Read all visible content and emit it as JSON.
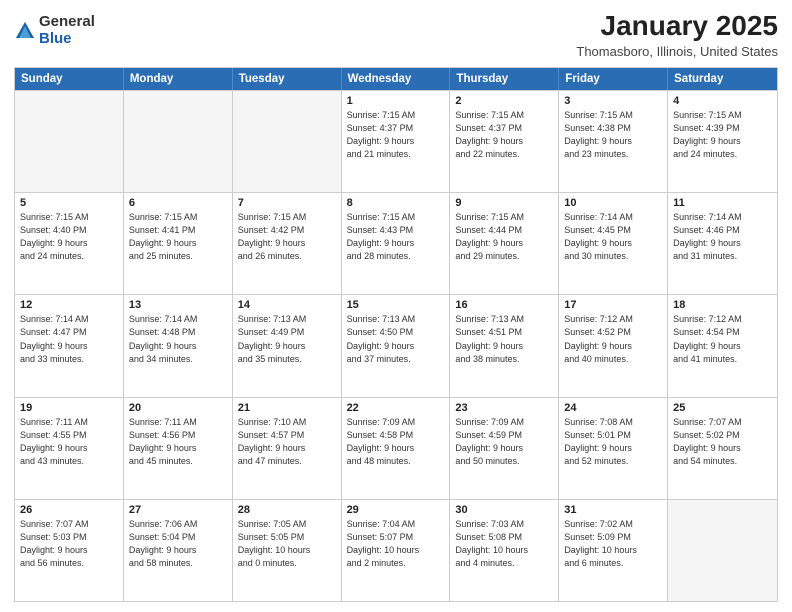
{
  "header": {
    "logo_general": "General",
    "logo_blue": "Blue",
    "title": "January 2025",
    "subtitle": "Thomasboro, Illinois, United States"
  },
  "calendar": {
    "days_of_week": [
      "Sunday",
      "Monday",
      "Tuesday",
      "Wednesday",
      "Thursday",
      "Friday",
      "Saturday"
    ],
    "rows": [
      [
        {
          "day": "",
          "lines": []
        },
        {
          "day": "",
          "lines": []
        },
        {
          "day": "",
          "lines": []
        },
        {
          "day": "1",
          "lines": [
            "Sunrise: 7:15 AM",
            "Sunset: 4:37 PM",
            "Daylight: 9 hours",
            "and 21 minutes."
          ]
        },
        {
          "day": "2",
          "lines": [
            "Sunrise: 7:15 AM",
            "Sunset: 4:37 PM",
            "Daylight: 9 hours",
            "and 22 minutes."
          ]
        },
        {
          "day": "3",
          "lines": [
            "Sunrise: 7:15 AM",
            "Sunset: 4:38 PM",
            "Daylight: 9 hours",
            "and 23 minutes."
          ]
        },
        {
          "day": "4",
          "lines": [
            "Sunrise: 7:15 AM",
            "Sunset: 4:39 PM",
            "Daylight: 9 hours",
            "and 24 minutes."
          ]
        }
      ],
      [
        {
          "day": "5",
          "lines": [
            "Sunrise: 7:15 AM",
            "Sunset: 4:40 PM",
            "Daylight: 9 hours",
            "and 24 minutes."
          ]
        },
        {
          "day": "6",
          "lines": [
            "Sunrise: 7:15 AM",
            "Sunset: 4:41 PM",
            "Daylight: 9 hours",
            "and 25 minutes."
          ]
        },
        {
          "day": "7",
          "lines": [
            "Sunrise: 7:15 AM",
            "Sunset: 4:42 PM",
            "Daylight: 9 hours",
            "and 26 minutes."
          ]
        },
        {
          "day": "8",
          "lines": [
            "Sunrise: 7:15 AM",
            "Sunset: 4:43 PM",
            "Daylight: 9 hours",
            "and 28 minutes."
          ]
        },
        {
          "day": "9",
          "lines": [
            "Sunrise: 7:15 AM",
            "Sunset: 4:44 PM",
            "Daylight: 9 hours",
            "and 29 minutes."
          ]
        },
        {
          "day": "10",
          "lines": [
            "Sunrise: 7:14 AM",
            "Sunset: 4:45 PM",
            "Daylight: 9 hours",
            "and 30 minutes."
          ]
        },
        {
          "day": "11",
          "lines": [
            "Sunrise: 7:14 AM",
            "Sunset: 4:46 PM",
            "Daylight: 9 hours",
            "and 31 minutes."
          ]
        }
      ],
      [
        {
          "day": "12",
          "lines": [
            "Sunrise: 7:14 AM",
            "Sunset: 4:47 PM",
            "Daylight: 9 hours",
            "and 33 minutes."
          ]
        },
        {
          "day": "13",
          "lines": [
            "Sunrise: 7:14 AM",
            "Sunset: 4:48 PM",
            "Daylight: 9 hours",
            "and 34 minutes."
          ]
        },
        {
          "day": "14",
          "lines": [
            "Sunrise: 7:13 AM",
            "Sunset: 4:49 PM",
            "Daylight: 9 hours",
            "and 35 minutes."
          ]
        },
        {
          "day": "15",
          "lines": [
            "Sunrise: 7:13 AM",
            "Sunset: 4:50 PM",
            "Daylight: 9 hours",
            "and 37 minutes."
          ]
        },
        {
          "day": "16",
          "lines": [
            "Sunrise: 7:13 AM",
            "Sunset: 4:51 PM",
            "Daylight: 9 hours",
            "and 38 minutes."
          ]
        },
        {
          "day": "17",
          "lines": [
            "Sunrise: 7:12 AM",
            "Sunset: 4:52 PM",
            "Daylight: 9 hours",
            "and 40 minutes."
          ]
        },
        {
          "day": "18",
          "lines": [
            "Sunrise: 7:12 AM",
            "Sunset: 4:54 PM",
            "Daylight: 9 hours",
            "and 41 minutes."
          ]
        }
      ],
      [
        {
          "day": "19",
          "lines": [
            "Sunrise: 7:11 AM",
            "Sunset: 4:55 PM",
            "Daylight: 9 hours",
            "and 43 minutes."
          ]
        },
        {
          "day": "20",
          "lines": [
            "Sunrise: 7:11 AM",
            "Sunset: 4:56 PM",
            "Daylight: 9 hours",
            "and 45 minutes."
          ]
        },
        {
          "day": "21",
          "lines": [
            "Sunrise: 7:10 AM",
            "Sunset: 4:57 PM",
            "Daylight: 9 hours",
            "and 47 minutes."
          ]
        },
        {
          "day": "22",
          "lines": [
            "Sunrise: 7:09 AM",
            "Sunset: 4:58 PM",
            "Daylight: 9 hours",
            "and 48 minutes."
          ]
        },
        {
          "day": "23",
          "lines": [
            "Sunrise: 7:09 AM",
            "Sunset: 4:59 PM",
            "Daylight: 9 hours",
            "and 50 minutes."
          ]
        },
        {
          "day": "24",
          "lines": [
            "Sunrise: 7:08 AM",
            "Sunset: 5:01 PM",
            "Daylight: 9 hours",
            "and 52 minutes."
          ]
        },
        {
          "day": "25",
          "lines": [
            "Sunrise: 7:07 AM",
            "Sunset: 5:02 PM",
            "Daylight: 9 hours",
            "and 54 minutes."
          ]
        }
      ],
      [
        {
          "day": "26",
          "lines": [
            "Sunrise: 7:07 AM",
            "Sunset: 5:03 PM",
            "Daylight: 9 hours",
            "and 56 minutes."
          ]
        },
        {
          "day": "27",
          "lines": [
            "Sunrise: 7:06 AM",
            "Sunset: 5:04 PM",
            "Daylight: 9 hours",
            "and 58 minutes."
          ]
        },
        {
          "day": "28",
          "lines": [
            "Sunrise: 7:05 AM",
            "Sunset: 5:05 PM",
            "Daylight: 10 hours",
            "and 0 minutes."
          ]
        },
        {
          "day": "29",
          "lines": [
            "Sunrise: 7:04 AM",
            "Sunset: 5:07 PM",
            "Daylight: 10 hours",
            "and 2 minutes."
          ]
        },
        {
          "day": "30",
          "lines": [
            "Sunrise: 7:03 AM",
            "Sunset: 5:08 PM",
            "Daylight: 10 hours",
            "and 4 minutes."
          ]
        },
        {
          "day": "31",
          "lines": [
            "Sunrise: 7:02 AM",
            "Sunset: 5:09 PM",
            "Daylight: 10 hours",
            "and 6 minutes."
          ]
        },
        {
          "day": "",
          "lines": []
        }
      ]
    ]
  }
}
